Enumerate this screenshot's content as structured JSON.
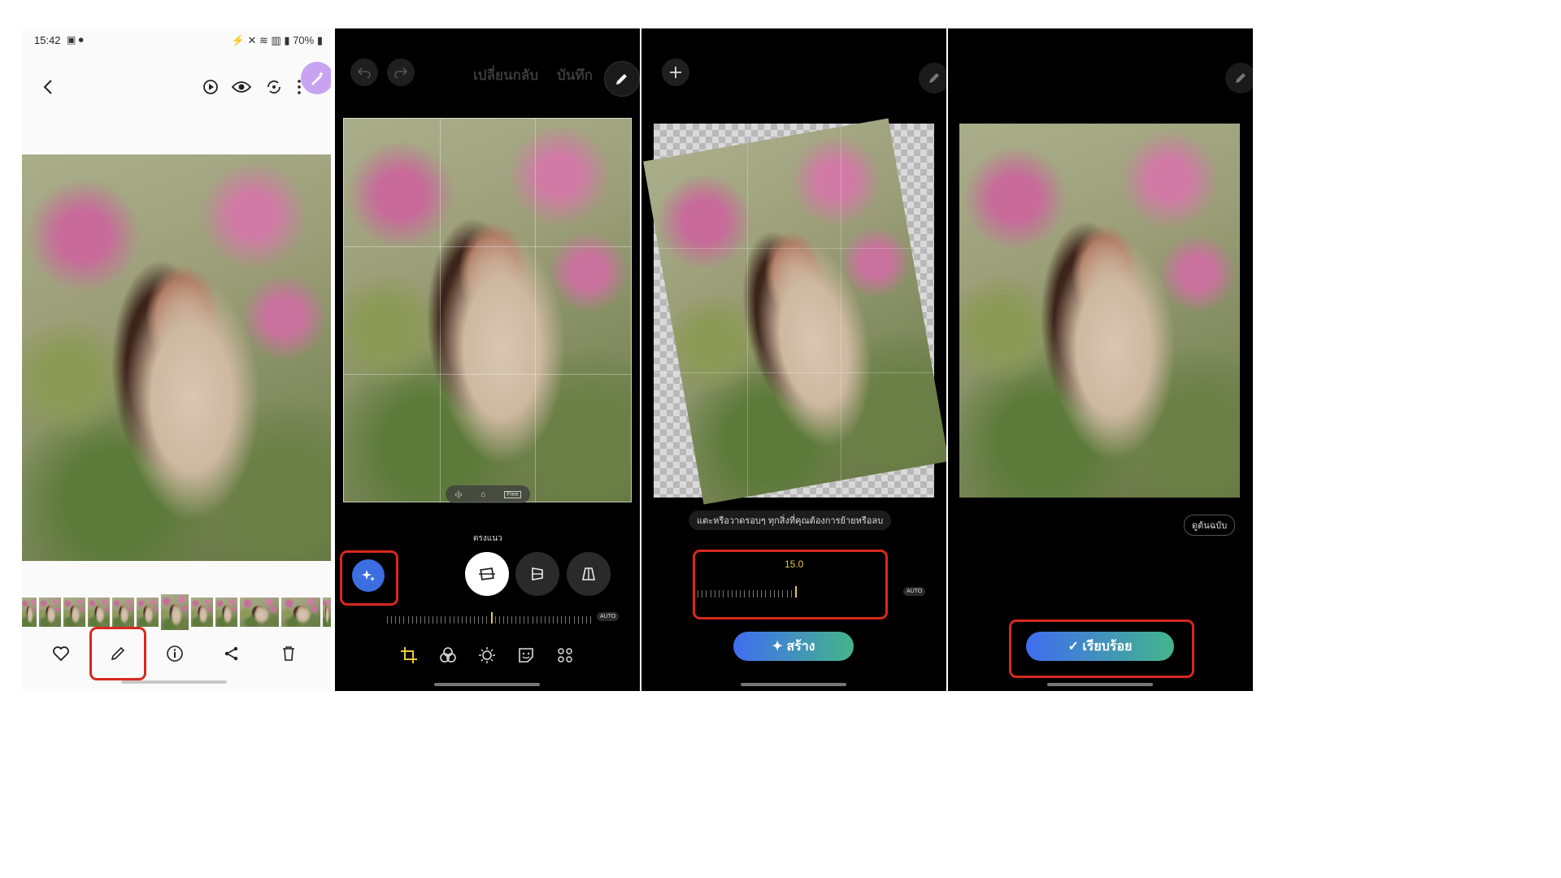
{
  "colors": {
    "highlight": "#d8281f",
    "accent_blue": "#3b6ee0",
    "gradient_start": "#3f6df0",
    "gradient_end": "#44b58a",
    "value_yellow": "#e8c840"
  },
  "panel1": {
    "status": {
      "time": "15:42",
      "battery": "70%"
    },
    "icons": [
      "back-icon",
      "remaster-icon",
      "eye-icon",
      "sync-icon",
      "more-icon",
      "ai-edit-icon",
      "heart-icon",
      "pencil-icon",
      "info-icon",
      "share-icon",
      "trash-icon"
    ]
  },
  "panel2": {
    "header": {
      "revert": "เปลี่ยนกลับ",
      "save": "บันทึก"
    },
    "section_label": "ตรงแนว",
    "auto_label": "AUTO",
    "free_label": "Free"
  },
  "panel3": {
    "hint": "แตะหรือวาดรอบๆ ทุกสิ่งที่คุณต้องการย้ายหรือลบ",
    "value": "15.0",
    "auto_label": "AUTO",
    "generate_button": "✦ สร้าง"
  },
  "panel4": {
    "view_original": "ดูต้นฉบับ",
    "done_button": "✓ เรียบร้อย"
  }
}
